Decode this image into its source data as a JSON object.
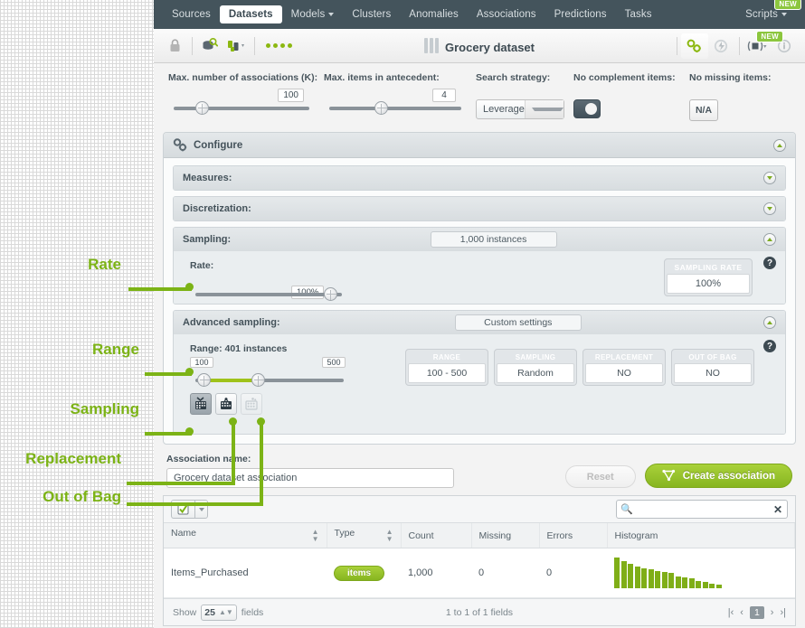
{
  "topnav": {
    "items": [
      {
        "label": "Sources",
        "active": false,
        "caret": false
      },
      {
        "label": "Datasets",
        "active": true,
        "caret": false
      },
      {
        "label": "Models",
        "active": false,
        "caret": true
      },
      {
        "label": "Clusters",
        "active": false,
        "caret": false
      },
      {
        "label": "Anomalies",
        "active": false,
        "caret": false
      },
      {
        "label": "Associations",
        "active": false,
        "caret": false
      },
      {
        "label": "Predictions",
        "active": false,
        "caret": false
      },
      {
        "label": "Tasks",
        "active": false,
        "caret": false
      }
    ],
    "right_item": "Scripts",
    "new_badge": "NEW"
  },
  "toolbar": {
    "title": "Grocery dataset",
    "icons": [
      "lock-icon",
      "dataset-search-icon",
      "model-dropdown-icon",
      "status-dots-icon"
    ],
    "right_icons": [
      "configure-gear-icon",
      "flash-icon",
      "list-dropdown-icon",
      "info-icon"
    ],
    "new_badge": "NEW"
  },
  "params": [
    {
      "label": "Max. number of associations (K):",
      "value": "100",
      "type": "slider",
      "knob_pct": 22
    },
    {
      "label": "Max. items in antecedent:",
      "value": "4",
      "type": "slider",
      "knob_pct": 38
    },
    {
      "label": "Search strategy:",
      "value": "Leverage",
      "type": "select"
    },
    {
      "label": "No complement items:",
      "value": "",
      "type": "toggle"
    },
    {
      "label": "No missing items:",
      "value": "N/A",
      "type": "na"
    }
  ],
  "configure": {
    "title": "Configure",
    "sections": [
      {
        "title": "Measures:",
        "pill": "",
        "expanded": false
      },
      {
        "title": "Discretization:",
        "pill": "",
        "expanded": false
      },
      {
        "title": "Sampling:",
        "pill": "1,000 instances",
        "expanded": true
      }
    ],
    "rate": {
      "label": "Rate:",
      "bubble": "100%",
      "knob_pct": 88,
      "stat_caption": "SAMPLING RATE",
      "stat_value": "100%",
      "help": "?"
    },
    "advanced": {
      "title": "Advanced sampling:",
      "pill": "Custom settings",
      "range_label": "Range: 401 instances",
      "range_min": "100",
      "range_max": "500",
      "knob_left_pct": 12,
      "knob_right_pct": 46,
      "stats": [
        {
          "caption": "RANGE",
          "value": "100 - 500"
        },
        {
          "caption": "SAMPLING",
          "value": "Random"
        },
        {
          "caption": "REPLACEMENT",
          "value": "NO"
        },
        {
          "caption": "OUT OF BAG",
          "value": "NO"
        }
      ],
      "help": "?",
      "sampling_icons": [
        "random-sampling-icon",
        "replacement-sampling-icon",
        "out-of-bag-sampling-icon"
      ]
    }
  },
  "association": {
    "name_label": "Association name:",
    "name_value": "Grocery dataset association",
    "name_placeholder": "Association name",
    "reset_label": "Reset",
    "create_label": "Create association"
  },
  "fields_table": {
    "search_placeholder": "",
    "search_value": "",
    "columns": [
      "Name",
      "Type",
      "Count",
      "Missing",
      "Errors",
      "Histogram"
    ],
    "rows": [
      {
        "name": "Items_Purchased",
        "type": "items",
        "count": "1,000",
        "missing": "0",
        "errors": "0"
      }
    ],
    "histogram": [
      34,
      30,
      27,
      24,
      22,
      21,
      19,
      18,
      17,
      13,
      12,
      11,
      8,
      7,
      5,
      4
    ],
    "footer": {
      "show_label": "Show",
      "page_size": "25",
      "fields_label": "fields",
      "summary": "1 to 1 of 1 fields",
      "current_page": "1"
    }
  },
  "callouts": [
    {
      "label": "Rate",
      "id": "callout-rate"
    },
    {
      "label": "Range",
      "id": "callout-range"
    },
    {
      "label": "Sampling",
      "id": "callout-sampling"
    },
    {
      "label": "Replacement",
      "id": "callout-replacement"
    },
    {
      "label": "Out of Bag",
      "id": "callout-out-of-bag"
    }
  ],
  "colors": {
    "accent_green": "#7cb316",
    "nav_dark": "#44545c",
    "button_green": "#87b520"
  }
}
